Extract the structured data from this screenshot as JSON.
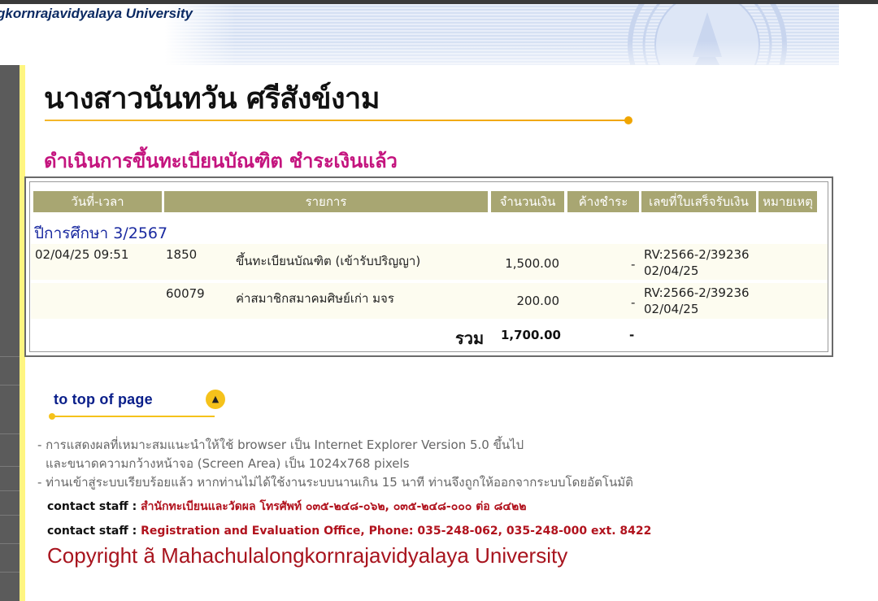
{
  "header": {
    "university_name": "gkornrajavidyalaya University"
  },
  "student": {
    "name": "นางสาวนันทวัน ศรีสังข์งาม"
  },
  "status": "ดำเนินการขึ้นทะเบียนบัณฑิต ชำระเงินแล้ว",
  "table": {
    "headers": [
      "วันที่-เวลา",
      "รายการ",
      "จำนวนเงิน",
      "ค้างชำระ",
      "เลขที่ใบเสร็จรับเงิน",
      "หมายเหตุ"
    ],
    "academic_year": "ปีการศึกษา 3/2567",
    "rows": [
      {
        "datetime": "02/04/25 09:51",
        "code": "1850",
        "item": "ขึ้นทะเบียนบัณฑิต (เข้ารับปริญญา)",
        "amount": "1,500.00",
        "outstanding": "-",
        "receipt_no": "RV:2566-2/39236",
        "receipt_date": "02/04/25"
      },
      {
        "datetime": "",
        "code": "60079",
        "item": "ค่าสมาชิกสมาคมศิษย์เก่า มจร",
        "amount": "200.00",
        "outstanding": "-",
        "receipt_no": "RV:2566-2/39236",
        "receipt_date": "02/04/25"
      }
    ],
    "total_label": "รวม",
    "total_amount": "1,700.00",
    "total_outstanding": "-"
  },
  "to_top": {
    "label": "to top of page",
    "icon": "up-arrow-icon"
  },
  "notes": [
    "- การแสดงผลที่เหมาะสมแนะนำให้ใช้ browser เป็น Internet Explorer Version 5.0 ขึ้นไป",
    "และขนาดความกว้างหน้าจอ (Screen Area) เป็น 1024x768 pixels",
    "- ท่านเข้าสู่ระบบเรียบร้อยแล้ว หากท่านไม่ได้ใช้งานระบบนานเกิน 15 นาที ท่านจึงถูกให้ออกจากระบบโดยอัตโนมัติ"
  ],
  "contacts": [
    {
      "label": "contact staff : ",
      "value": "สำนักทะเบียนและวัดผล โทรศัพท์ ๐๓๕-๒๔๘-๐๖๒, ๐๓๕-๒๔๘-๐๐๐ ต่อ ๘๔๒๒"
    },
    {
      "label": "contact staff : ",
      "value": "Registration and Evaluation Office, Phone: 035-248-062, 035-248-000 ext. 8422"
    }
  ],
  "copyright": "Copyright ã Mahachulalongkornrajavidyalaya University",
  "colors": {
    "header_cell": "#a8a672",
    "status_text": "#c4147e",
    "accent_gold": "#f0a500",
    "link_blue": "#1a2aa0",
    "copyright_red": "#a8141e"
  }
}
